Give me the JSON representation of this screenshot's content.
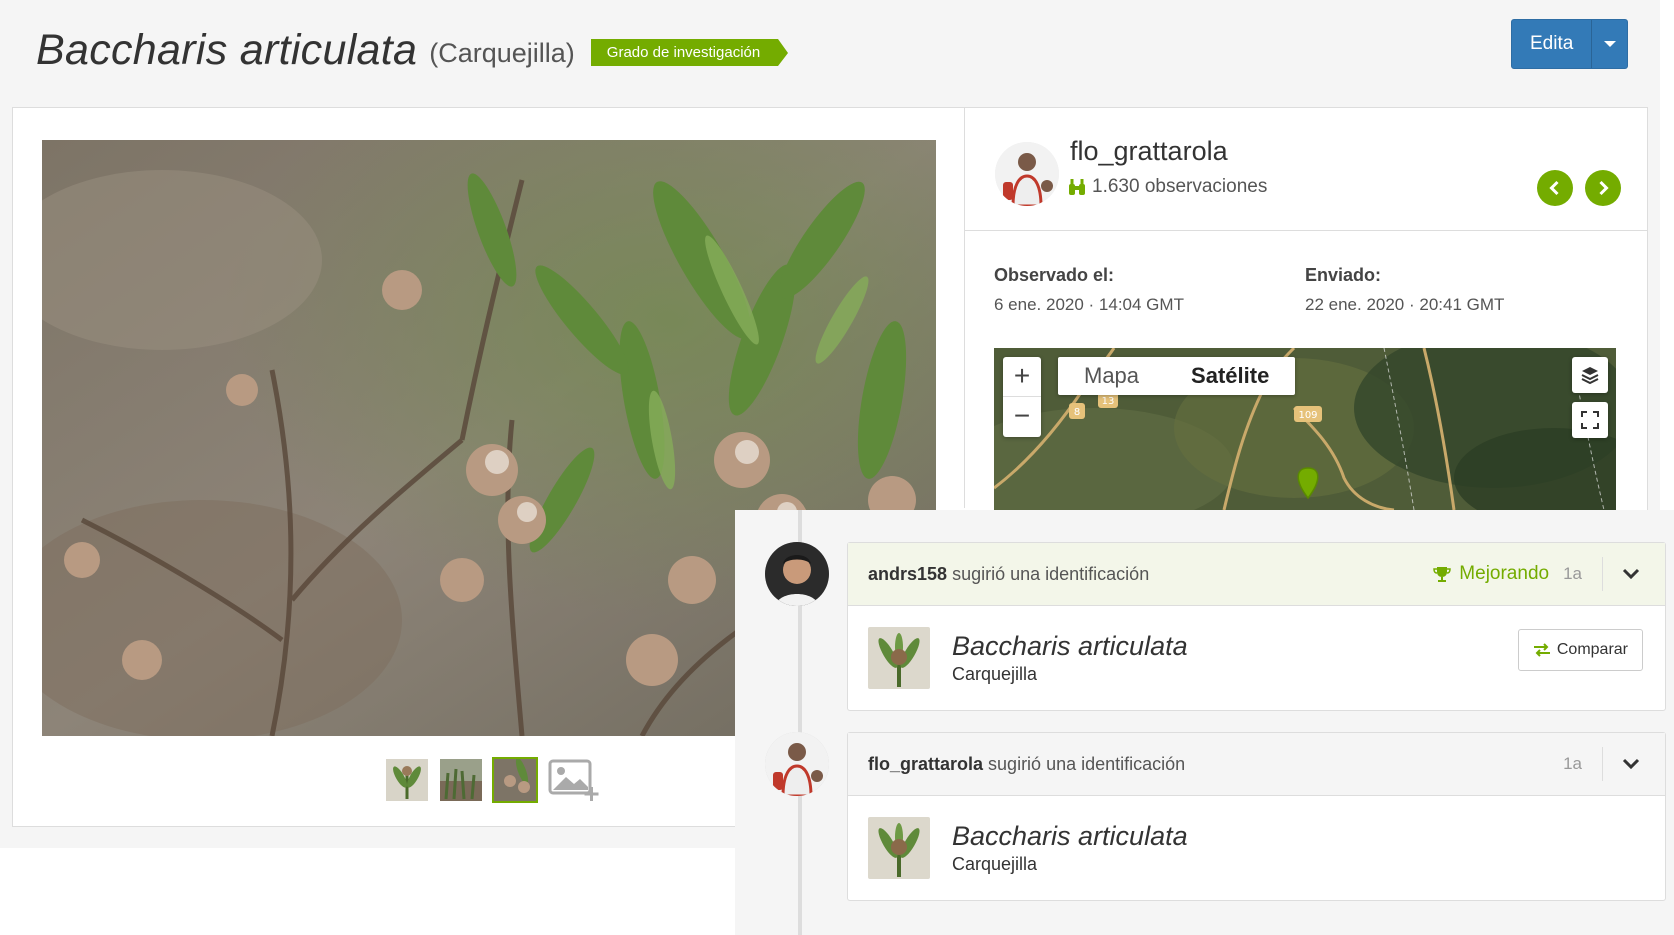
{
  "header": {
    "scientific_name": "Baccharis articulata",
    "common_name": "(Carquejilla)",
    "quality_grade": "Grado de investigación",
    "edit_label": "Edita"
  },
  "observer": {
    "username": "flo_grattarola",
    "observations": "1.630 observaciones"
  },
  "details": {
    "observed_label": "Observado el:",
    "observed_value": "6 ene. 2020 · 14:04 GMT",
    "submitted_label": "Enviado:",
    "submitted_value": "22 ene. 2020 · 20:41 GMT"
  },
  "map": {
    "zoom_in": "+",
    "zoom_out": "−",
    "type_map": "Mapa",
    "type_satellite": "Satélite",
    "road_labels": [
      "8",
      "13",
      "109"
    ]
  },
  "activity": [
    {
      "user": "andrs158",
      "action": "sugirió una identificación",
      "status": "Mejorando",
      "time": "1a",
      "taxon_sci": "Baccharis articulata",
      "taxon_common": "Carquejilla",
      "compare_label": "Comparar"
    },
    {
      "user": "flo_grattarola",
      "action": "sugirió una identificación",
      "time": "1a",
      "taxon_sci": "Baccharis articulata",
      "taxon_common": "Carquejilla"
    }
  ],
  "colors": {
    "accent_green": "#74ac00",
    "primary_blue": "#337ab7"
  }
}
